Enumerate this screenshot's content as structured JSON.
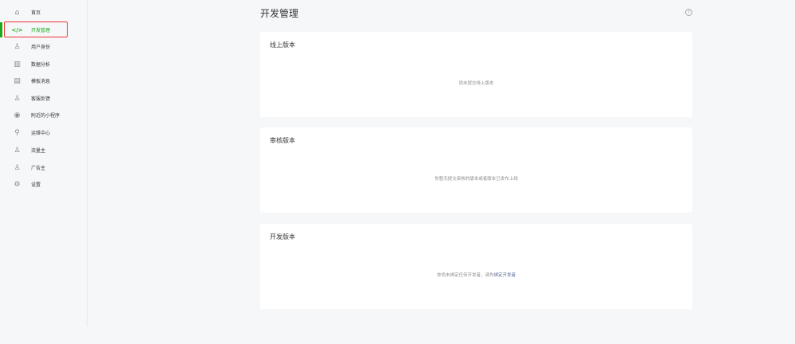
{
  "sidebar": {
    "items": [
      {
        "label": "首页",
        "icon": "home-icon"
      },
      {
        "label": "开发管理",
        "icon": "code-icon",
        "active": true
      },
      {
        "label": "用户身份",
        "icon": "user-icon"
      },
      {
        "label": "数据分析",
        "icon": "chart-icon"
      },
      {
        "label": "模板消息",
        "icon": "document-icon"
      },
      {
        "label": "客服反馈",
        "icon": "support-icon"
      },
      {
        "label": "附近的小程序",
        "icon": "location-icon"
      },
      {
        "label": "运维中心",
        "icon": "wrench-icon"
      },
      {
        "label": "流量主",
        "icon": "user-traffic-icon"
      },
      {
        "label": "广告主",
        "icon": "user-ad-icon"
      },
      {
        "label": "设置",
        "icon": "gear-icon"
      }
    ]
  },
  "page": {
    "title": "开发管理",
    "help": "?"
  },
  "cards": [
    {
      "title": "线上版本",
      "empty": "尚未提交线上版本"
    },
    {
      "title": "审核版本",
      "empty": "你暂无提交审核的版本或者版本已发布上线"
    },
    {
      "title": "开发版本",
      "empty": "你尚未绑定任何开发者，请先",
      "link": "绑定开发者"
    }
  ],
  "colors": {
    "accent": "#1aad19",
    "link": "#576b95",
    "highlight": "#ee3333"
  }
}
